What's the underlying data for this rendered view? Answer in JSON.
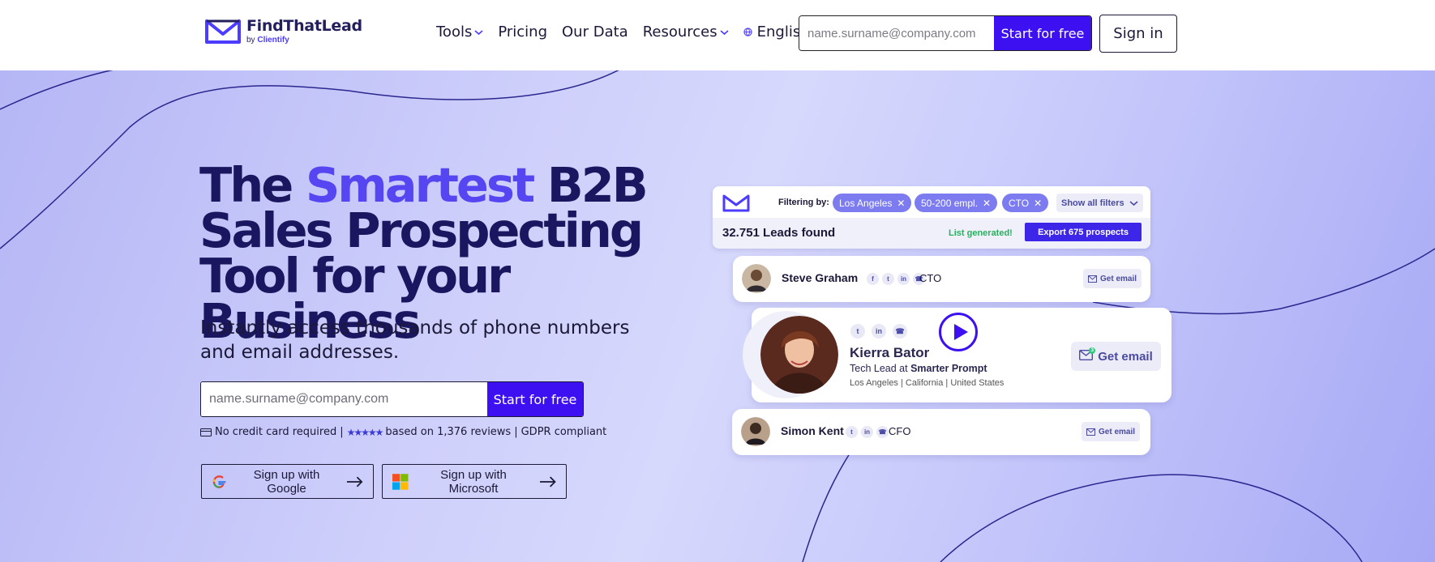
{
  "brand": {
    "name": "FindThatLead",
    "by_prefix": "by",
    "by_name": "Clientify"
  },
  "nav": {
    "items": [
      {
        "label": "Tools",
        "dropdown": true
      },
      {
        "label": "Pricing",
        "dropdown": false
      },
      {
        "label": "Our Data",
        "dropdown": false
      },
      {
        "label": "Resources",
        "dropdown": true
      },
      {
        "label": "English",
        "dropdown": true
      }
    ]
  },
  "header_form": {
    "placeholder": "name.surname@company.com",
    "button": "Start for free"
  },
  "signin": "Sign in",
  "hero": {
    "headline_1": "The ",
    "headline_accent": "Smartest",
    "headline_2": " B2B Sales Prospecting Tool for your Business",
    "subline": "Instantly access thousands of phone numbers and email addresses.",
    "form": {
      "placeholder": "name.surname@company.com",
      "button": "Start for free"
    },
    "trust": {
      "no_card": "No credit card required",
      "sep": "|",
      "stars": "★★★★★",
      "reviews": "based on 1,376 reviews",
      "gdpr": "GDPR compliant"
    },
    "google_button": "Sign up with Google",
    "microsoft_button": "Sign up with Microsoft"
  },
  "mockup": {
    "filter_label": "Filtering by:",
    "chips": [
      "Los Angeles",
      "50-200 empl.",
      "CTO"
    ],
    "show_all": "Show all filters",
    "leads_found": "32.751 Leads found",
    "list_generated": "List generated!",
    "export": "Export 675 prospects",
    "people": [
      {
        "name": "Steve Graham",
        "role": "CTO",
        "button": "Get email"
      },
      {
        "name": "Kierra Bator",
        "title": "Tech Lead",
        "at": "at",
        "company": "Smarter Prompt",
        "location": "Los Angeles | California | United States",
        "button": "Get email",
        "badge": "3"
      },
      {
        "name": "Simon Kent",
        "role": "CFO",
        "button": "Get email"
      }
    ]
  },
  "colors": {
    "brand_purple": "#3d10f2",
    "accent": "#5546f2",
    "headline": "#1b1660"
  }
}
